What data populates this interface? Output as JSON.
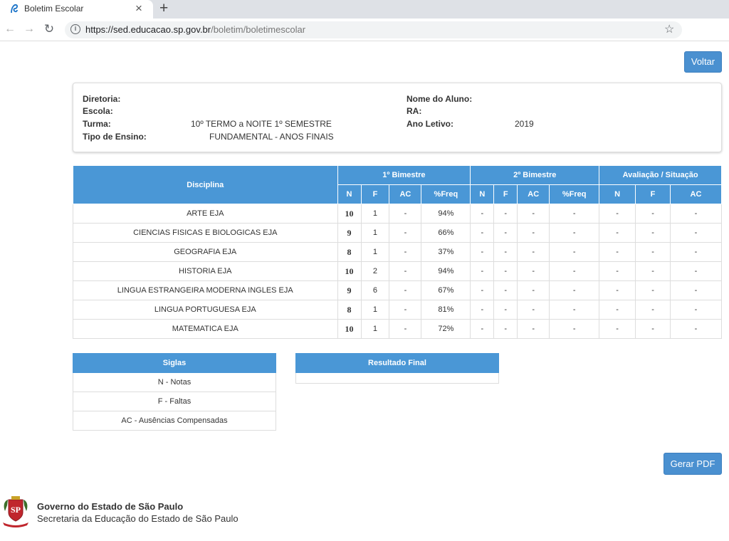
{
  "browser": {
    "tab_title": "Boletim Escolar",
    "url_host": "https://sed.educacao.sp.gov.br",
    "url_path": "/boletim/boletimescolar"
  },
  "actions": {
    "voltar": "Voltar",
    "gerar_pdf": "Gerar PDF"
  },
  "info": {
    "diretoria_label": "Diretoria:",
    "diretoria_value": "",
    "escola_label": "Escola:",
    "escola_value": "",
    "turma_label": "Turma:",
    "turma_value": "10º TERMO a NOITE 1º SEMESTRE",
    "tipo_label": "Tipo de Ensino:",
    "tipo_value": "FUNDAMENTAL - ANOS FINAIS",
    "nome_label": "Nome do Aluno:",
    "nome_value": "",
    "ra_label": "RA:",
    "ra_value": "",
    "ano_label": "Ano Letivo:",
    "ano_value": "2019"
  },
  "grades": {
    "header_disciplina": "Disciplina",
    "groups": [
      "1º Bimestre",
      "2º Bimestre",
      "Avaliação / Situação"
    ],
    "sub_cols": [
      "N",
      "F",
      "AC",
      "%Freq",
      "N",
      "F",
      "AC",
      "%Freq",
      "N",
      "F",
      "AC"
    ],
    "rows": [
      {
        "disciplina": "ARTE EJA",
        "cells": [
          "10",
          "1",
          "-",
          "94%",
          "-",
          "-",
          "-",
          "-",
          "-",
          "-",
          "-"
        ]
      },
      {
        "disciplina": "CIENCIAS FISICAS E BIOLOGICAS EJA",
        "cells": [
          "9",
          "1",
          "-",
          "66%",
          "-",
          "-",
          "-",
          "-",
          "-",
          "-",
          "-"
        ]
      },
      {
        "disciplina": "GEOGRAFIA EJA",
        "cells": [
          "8",
          "1",
          "-",
          "37%",
          "-",
          "-",
          "-",
          "-",
          "-",
          "-",
          "-"
        ]
      },
      {
        "disciplina": "HISTORIA EJA",
        "cells": [
          "10",
          "2",
          "-",
          "94%",
          "-",
          "-",
          "-",
          "-",
          "-",
          "-",
          "-"
        ]
      },
      {
        "disciplina": "LINGUA ESTRANGEIRA MODERNA INGLES EJA",
        "cells": [
          "9",
          "6",
          "-",
          "67%",
          "-",
          "-",
          "-",
          "-",
          "-",
          "-",
          "-"
        ]
      },
      {
        "disciplina": "LINGUA PORTUGUESA EJA",
        "cells": [
          "8",
          "1",
          "-",
          "81%",
          "-",
          "-",
          "-",
          "-",
          "-",
          "-",
          "-"
        ]
      },
      {
        "disciplina": "MATEMATICA EJA",
        "cells": [
          "10",
          "1",
          "-",
          "72%",
          "-",
          "-",
          "-",
          "-",
          "-",
          "-",
          "-"
        ]
      }
    ]
  },
  "siglas": {
    "title": "Siglas",
    "items": [
      "N - Notas",
      "F - Faltas",
      "AC - Ausências Compensadas"
    ]
  },
  "resultado": {
    "title": "Resultado Final",
    "value": ""
  },
  "footer": {
    "title": "Governo do Estado de São Paulo",
    "subtitle": "Secretaria da Educação do Estado de São Paulo"
  },
  "colors": {
    "accent": "#4a97d6",
    "button": "#4a90d0"
  },
  "icons": [
    "sp-favicon-icon",
    "close-icon",
    "plus-icon",
    "back-arrow-icon",
    "forward-arrow-icon",
    "reload-icon",
    "info-icon",
    "star-icon",
    "sp-coat-of-arms-logo"
  ]
}
